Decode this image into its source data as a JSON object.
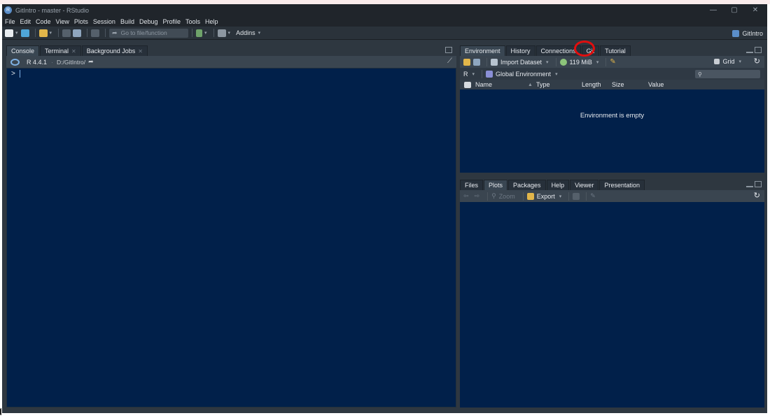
{
  "window": {
    "title": "GitIntro - master - RStudio",
    "app_icon": "R"
  },
  "menu": [
    "File",
    "Edit",
    "Code",
    "View",
    "Plots",
    "Session",
    "Build",
    "Debug",
    "Profile",
    "Tools",
    "Help"
  ],
  "toolbar": {
    "goto_placeholder": "Go to file/function",
    "addins_label": "Addins",
    "project_label": "GitIntro"
  },
  "left_pane": {
    "tabs": [
      "Console",
      "Terminal",
      "Background Jobs"
    ],
    "r_version": "R 4.4.1",
    "path": "D:/GitIntro/",
    "prompt": ">"
  },
  "top_right_pane": {
    "tabs": [
      "Environment",
      "History",
      "Connections",
      "Git",
      "Tutorial"
    ],
    "import_dataset": "Import Dataset",
    "memory": "119 MiB",
    "view_mode": "Grid",
    "r_label": "R",
    "env_scope": "Global Environment",
    "columns": [
      "Name",
      "Type",
      "Length",
      "Size",
      "Value"
    ],
    "empty_message": "Environment is empty"
  },
  "bottom_right_pane": {
    "tabs": [
      "Files",
      "Plots",
      "Packages",
      "Help",
      "Viewer",
      "Presentation"
    ],
    "zoom_label": "Zoom",
    "export_label": "Export"
  },
  "colors": {
    "console_bg": "#01204a",
    "chrome": "#2e3740",
    "highlight_ring": "#e10e0e"
  }
}
